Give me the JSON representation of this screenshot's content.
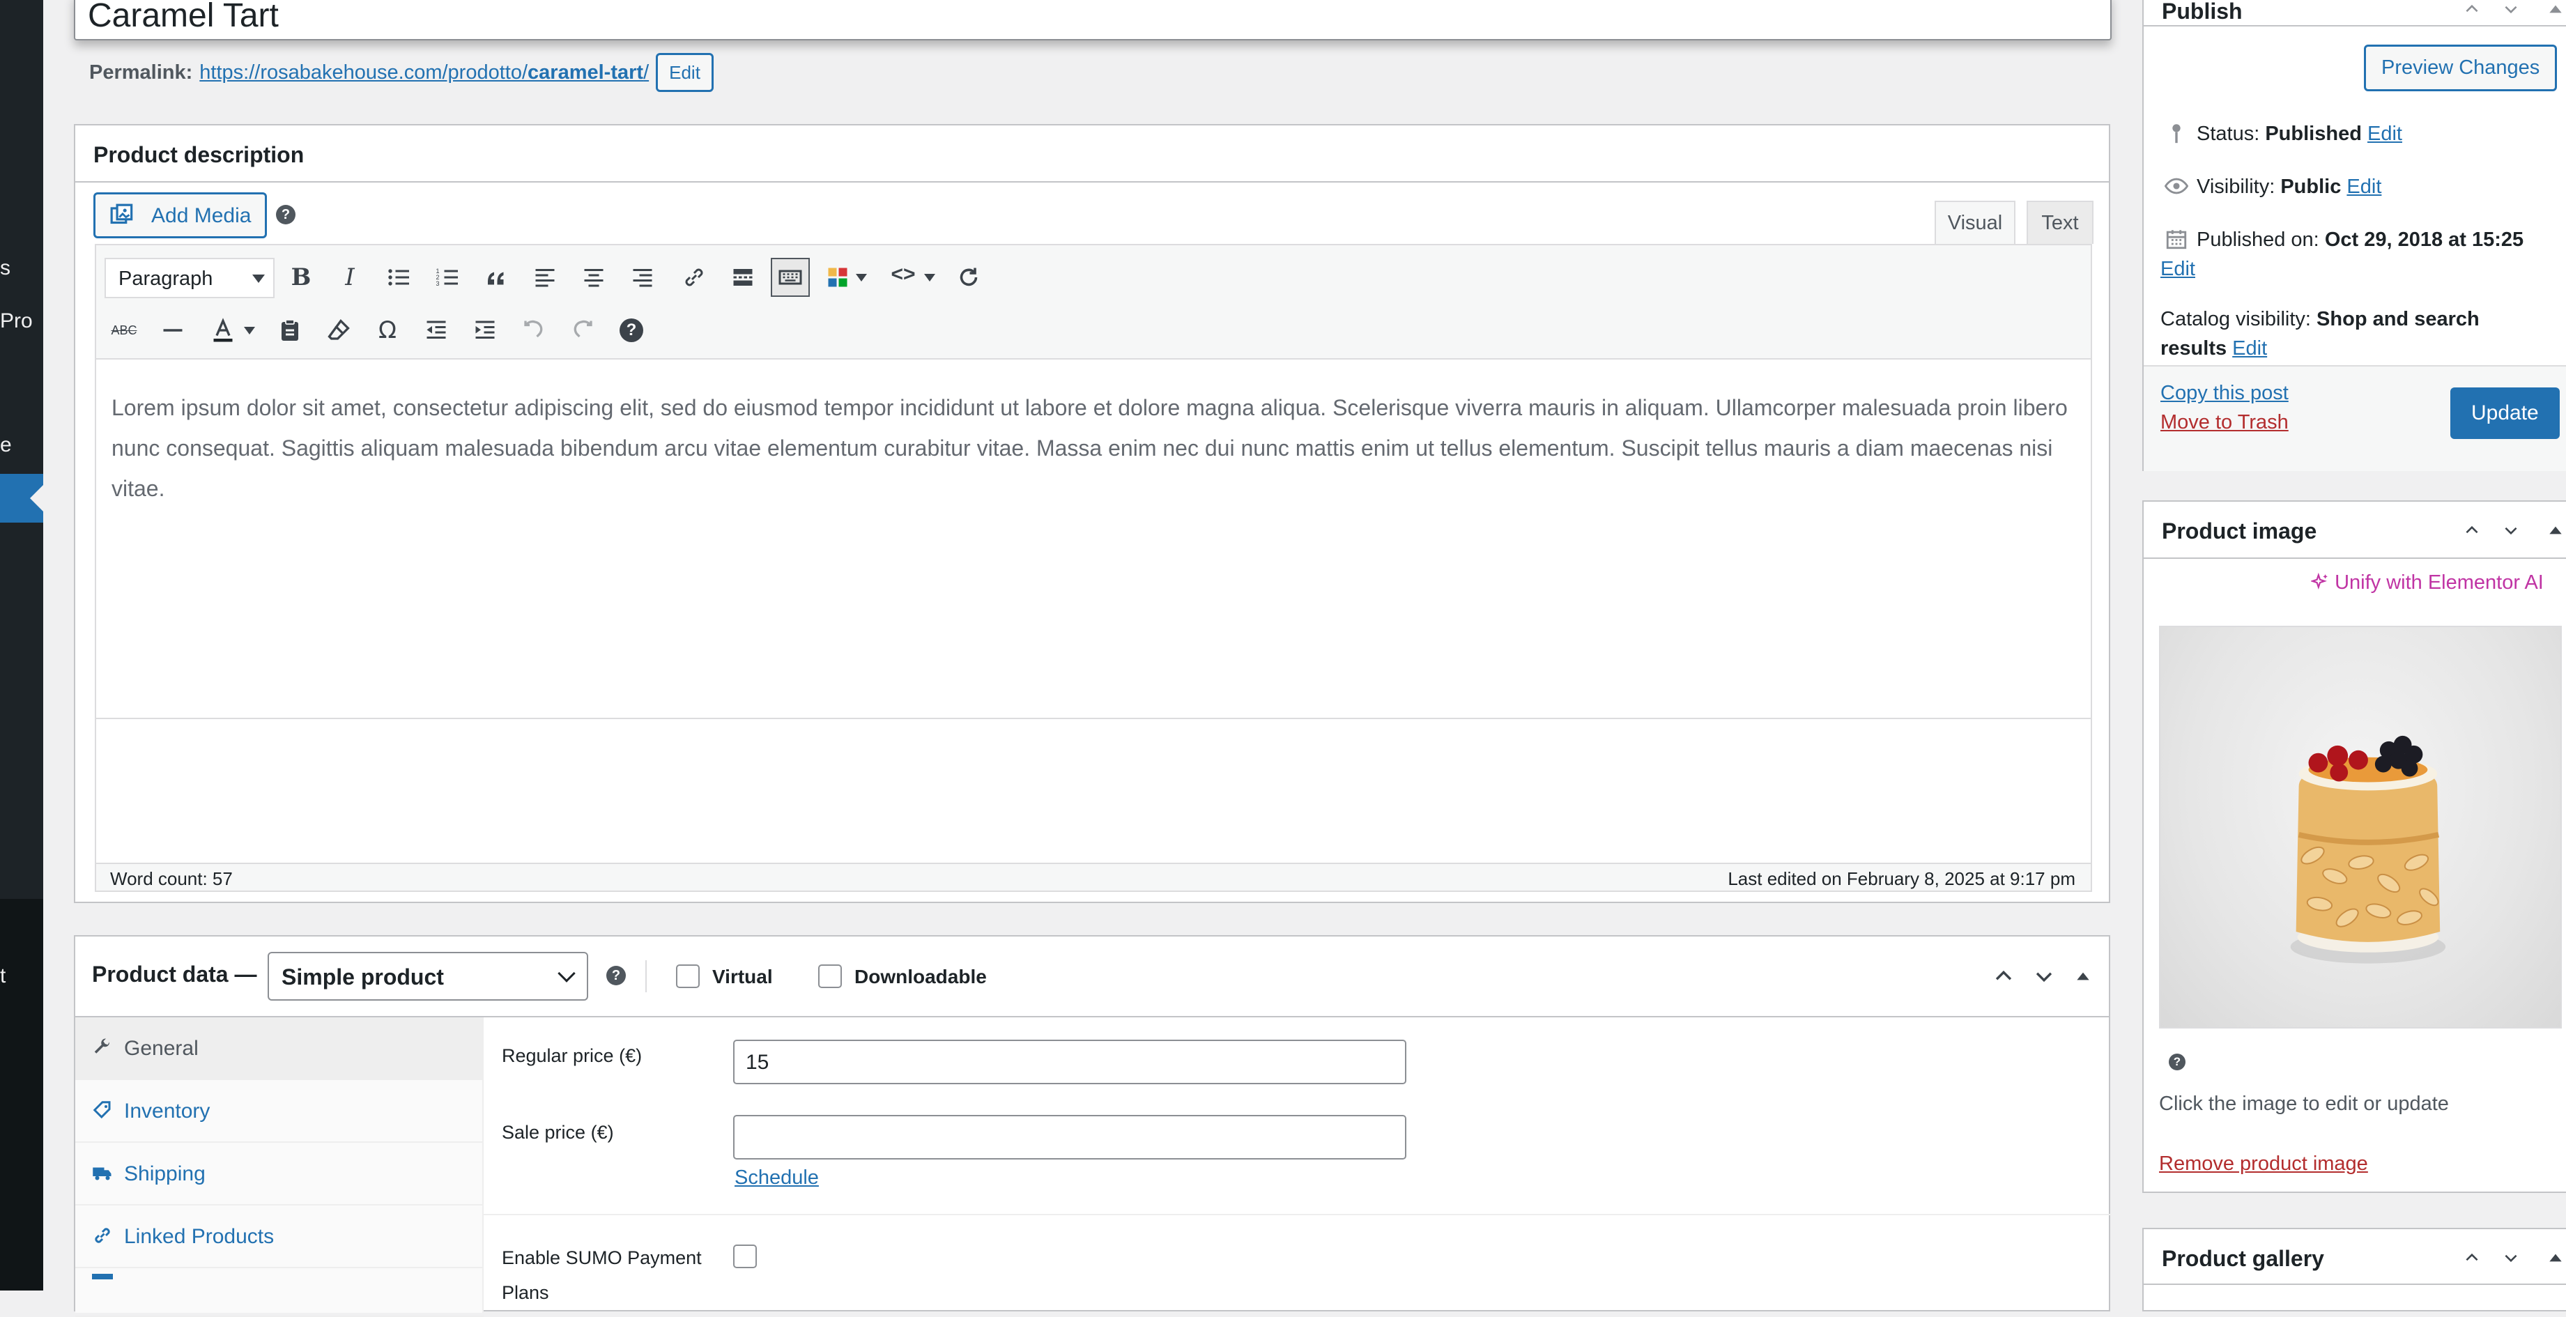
{
  "admin_sidebar": {
    "fragments": [
      "s",
      "Pro",
      "e",
      "t"
    ]
  },
  "title": {
    "value": "Caramel Tart"
  },
  "permalink": {
    "label": "Permalink:",
    "url_prefix": "https://rosabakehouse.com/prodotto/",
    "slug": "caramel-tart",
    "url_suffix": "/",
    "edit_label": "Edit"
  },
  "description": {
    "title": "Product description",
    "add_media_label": "Add Media",
    "help_glyph": "?",
    "tab_visual": "Visual",
    "tab_text": "Text",
    "format_select": "Paragraph",
    "toolbar_row1": [
      "bold-icon",
      "italic-icon",
      "bullet-list-icon",
      "numbered-list-icon",
      "blockquote-icon",
      "align-left-icon",
      "align-center-icon",
      "align-right-icon",
      "link-icon",
      "read-more-icon",
      "toolbar-toggle-icon",
      "color-grid-icon",
      "code-icon",
      "refresh-icon"
    ],
    "toolbar_row2": [
      "strikethrough-icon",
      "horizontal-line-icon",
      "text-color-icon",
      "paste-text-icon",
      "clear-formatting-icon",
      "special-character-icon",
      "outdent-icon",
      "indent-icon",
      "undo-icon",
      "redo-icon",
      "keyboard-shortcuts-icon"
    ],
    "body_text": "Lorem ipsum dolor sit amet, consectetur adipiscing elit, sed do eiusmod tempor incididunt ut labore et dolore magna aliqua. Scelerisque viverra mauris in aliquam. Ullamcorper malesuada proin libero nunc consequat. Sagittis aliquam malesuada bibendum arcu vitae elementum curabitur vitae. Massa enim nec dui nunc mattis enim ut tellus elementum. Suscipit tellus mauris a diam maecenas nisi vitae.",
    "word_count": "Word count: 57",
    "last_edited": "Last edited on February 8, 2025 at 9:17 pm"
  },
  "product_data": {
    "title": "Product data —",
    "type_value": "Simple product",
    "virtual_label": "Virtual",
    "downloadable_label": "Downloadable",
    "tabs": [
      {
        "label": "General",
        "icon": "wrench-icon"
      },
      {
        "label": "Inventory",
        "icon": "tag-icon"
      },
      {
        "label": "Shipping",
        "icon": "truck-icon"
      },
      {
        "label": "Linked Products",
        "icon": "link-icon"
      }
    ],
    "regular_price_label": "Regular price (€)",
    "regular_price_value": "15",
    "sale_price_label": "Sale price (€)",
    "sale_price_value": "",
    "schedule_label": "Schedule",
    "sumo_label": "Enable SUMO Payment",
    "sumo_label_cont": "Plans"
  },
  "publish": {
    "title": "Publish",
    "preview_label": "Preview Changes",
    "status_label": "Status:",
    "status_value": "Published",
    "visibility_label": "Visibility:",
    "visibility_value": "Public",
    "published_on_label": "Published on:",
    "published_on_value": "Oct 29, 2018 at 15:25",
    "catalog_label": "Catalog visibility:",
    "catalog_value_1": "Shop and search",
    "catalog_value_2": "results",
    "edit_label": "Edit",
    "copy_label": "Copy this post",
    "trash_label": "Move to Trash",
    "update_label": "Update"
  },
  "product_image": {
    "title": "Product image",
    "elementor_label": "Unify with Elementor AI",
    "help_glyph": "?",
    "hint": "Click the image to edit or update",
    "remove_label": "Remove product image"
  },
  "product_gallery": {
    "title": "Product gallery"
  },
  "colors": {
    "admin_dark": "#1d2327",
    "accent_blue": "#2271b1",
    "trash_red": "#b32d2e",
    "elementor_pink": "#c034a4"
  }
}
